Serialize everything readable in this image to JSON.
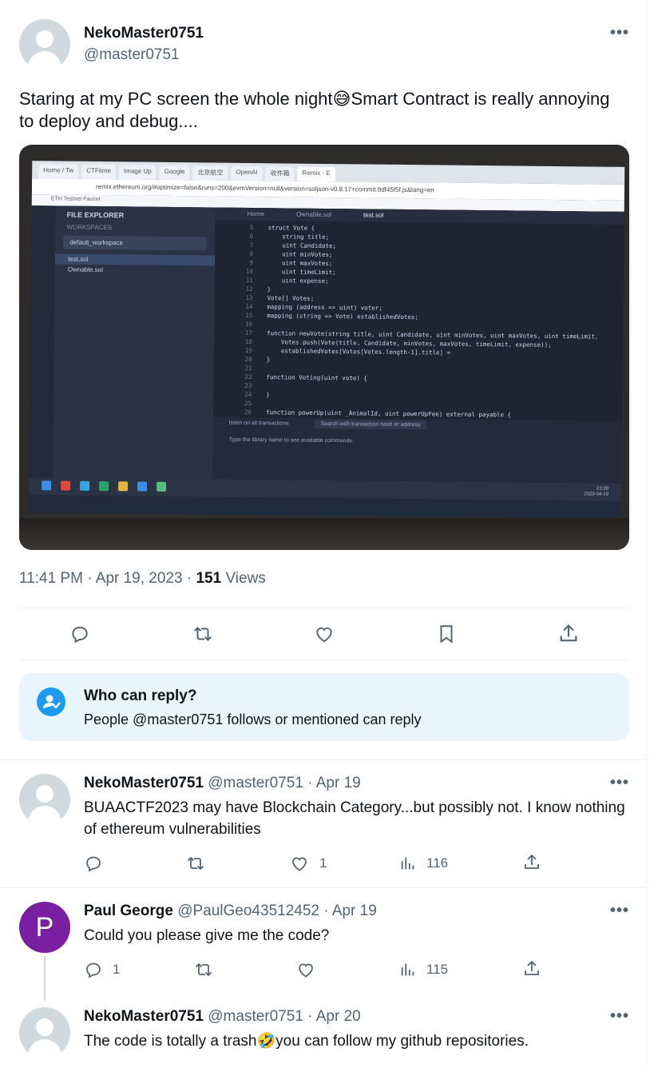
{
  "tweet": {
    "author_name": "NekoMaster0751",
    "author_handle": "@master0751",
    "text": "Staring at my PC screen the whole night😅Smart Contract is really annoying to deploy and debug....",
    "time": "11:41 PM",
    "date": "Apr 19, 2023",
    "sep": "·",
    "views_count": "151",
    "views_label": "Views",
    "more_label": "•••"
  },
  "photo": {
    "tabs": [
      "Home / Tw",
      "CTFtime",
      "Image Up",
      "Google",
      "北京航空",
      "OpenAI",
      "收件箱",
      "Remix - E"
    ],
    "url": "remix.ethereum.org/#optimize=false&runs=200&evmVersion=null&version=soljson-v0.8.17+commit.8df45f5f.js&lang=en",
    "bookmark": "ETH Testnet Faucet",
    "panel_title": "FILE EXPLORER",
    "workspaces_label": "WORKSPACES",
    "workspace": "default_workspace",
    "files": [
      "test.sol",
      "Ownable.sol"
    ],
    "editor_tabs": [
      "Home",
      "Ownable.sol",
      "test.sol"
    ],
    "code": [
      {
        "n": "5",
        "t": "struct Vote {"
      },
      {
        "n": "6",
        "t": "    string title;"
      },
      {
        "n": "7",
        "t": "    uint Candidate;"
      },
      {
        "n": "8",
        "t": "    uint minVotes;"
      },
      {
        "n": "9",
        "t": "    uint maxVotes;"
      },
      {
        "n": "10",
        "t": "    uint timeLimit;"
      },
      {
        "n": "11",
        "t": "    uint expense;"
      },
      {
        "n": "12",
        "t": "}"
      },
      {
        "n": "13",
        "t": "Vote[] Votes;"
      },
      {
        "n": "14",
        "t": "mapping (address => uint) voter;"
      },
      {
        "n": "15",
        "t": "mapping (string => Vote) establishedVotes;"
      },
      {
        "n": "16",
        "t": ""
      },
      {
        "n": "17",
        "t": "function newVote(string title, uint Candidate, uint minVotes, uint maxVotes, uint timeLimit,"
      },
      {
        "n": "18",
        "t": "    Votes.push(Vote(title, Candidate, minVotes, maxVotes, timeLimit, expense));"
      },
      {
        "n": "19",
        "t": "    establishedVotes[Votes[Votes.length-1].title] ="
      },
      {
        "n": "20",
        "t": "}"
      },
      {
        "n": "21",
        "t": ""
      },
      {
        "n": "22",
        "t": "function Voting(uint vote) {"
      },
      {
        "n": "23",
        "t": ""
      },
      {
        "n": "24",
        "t": "}"
      },
      {
        "n": "25",
        "t": ""
      },
      {
        "n": "26",
        "t": "function powerUp(uint _AnimalId, uint powerUpFee) external payable {"
      }
    ],
    "terminal_listen": "listen on all transactions",
    "terminal_search": "Search with transaction hash or address",
    "terminal_hint": "Type the library name to see available commands.",
    "clock_time": "23:39",
    "clock_date": "2023-04-19"
  },
  "actions": {
    "reply_icon": "reply-icon",
    "retweet_icon": "retweet-icon",
    "like_icon": "heart-icon",
    "bookmark_icon": "bookmark-icon",
    "share_icon": "share-icon"
  },
  "who_can_reply": {
    "title": "Who can reply?",
    "text": "People @master0751 follows or mentioned can reply"
  },
  "replies": [
    {
      "name": "NekoMaster0751",
      "handle": "@master0751",
      "date": "Apr 19",
      "text": "BUAACTF2023 may have Blockchain Category...but possibly not. I know nothing of ethereum vulnerabilities",
      "reply_count": "",
      "retweet_count": "",
      "like_count": "1",
      "view_count": "116"
    },
    {
      "name": "Paul George",
      "handle": "@PaulGeo43512452",
      "date": "Apr 19",
      "avatar_letter": "P",
      "avatar_color": "#7b1fa2",
      "text": "Could you please give me the code?",
      "reply_count": "1",
      "retweet_count": "",
      "like_count": "",
      "view_count": "115"
    },
    {
      "name": "NekoMaster0751",
      "handle": "@master0751",
      "date": "Apr 20",
      "text": "The code is totally a trash🤣you can follow my github repositories."
    }
  ],
  "colors": {
    "accent": "#1d9bf0",
    "muted": "#536471",
    "reply_box_bg": "#e8f5fd"
  }
}
